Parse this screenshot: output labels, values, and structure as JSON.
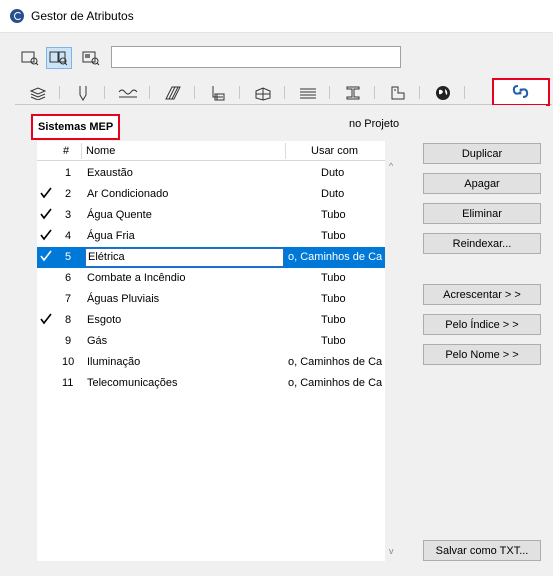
{
  "window": {
    "title": "Gestor de Atributos"
  },
  "search": {
    "value": "",
    "placeholder": ""
  },
  "view_buttons": [
    "list-view-icon",
    "split-view-icon",
    "preview-view-icon"
  ],
  "tabs": [
    "layers-icon",
    "pens-icon",
    "line-types-icon",
    "fill-types-icon",
    "composites-icon",
    "building-materials-icon",
    "profiles-icon",
    "surfaces-icon",
    "zone-categories-icon",
    "locations-icon",
    "mep-systems-icon"
  ],
  "panel": {
    "title": "Sistemas MEP",
    "scope_label": "no Projeto"
  },
  "table": {
    "columns": [
      "#",
      "Nome",
      "Usar com"
    ],
    "rows": [
      {
        "check": false,
        "num": "1",
        "name": "Exaustão",
        "use": "Duto"
      },
      {
        "check": true,
        "num": "2",
        "name": "Ar Condicionado",
        "use": "Duto"
      },
      {
        "check": true,
        "num": "3",
        "name": "Água Quente",
        "use": "Tubo"
      },
      {
        "check": true,
        "num": "4",
        "name": "Água Fria",
        "use": "Tubo"
      },
      {
        "check": true,
        "num": "5",
        "name": "Elétrica",
        "use": "o, Caminhos de Ca",
        "selected": true
      },
      {
        "check": false,
        "num": "6",
        "name": "Combate a Incêndio",
        "use": "Tubo"
      },
      {
        "check": false,
        "num": "7",
        "name": "Águas Pluviais",
        "use": "Tubo"
      },
      {
        "check": true,
        "num": "8",
        "name": "Esgoto",
        "use": "Tubo"
      },
      {
        "check": false,
        "num": "9",
        "name": "Gás",
        "use": "Tubo"
      },
      {
        "check": false,
        "num": "10",
        "name": "Iluminação",
        "use": "o, Caminhos de Ca"
      },
      {
        "check": false,
        "num": "11",
        "name": "Telecomunicações",
        "use": "o, Caminhos de Ca"
      }
    ]
  },
  "buttons": {
    "duplicate": "Duplicar",
    "delete": "Apagar",
    "eliminate": "Eliminar",
    "reindex": "Reindexar...",
    "append": "Acrescentar > >",
    "by_index": "Pelo Índice > >",
    "by_name": "Pelo Nome > >",
    "save_txt": "Salvar como TXT..."
  },
  "colors": {
    "accent": "#0078d7",
    "highlight": "#e8001c",
    "tab_active_icon": "#1e5fa8"
  }
}
